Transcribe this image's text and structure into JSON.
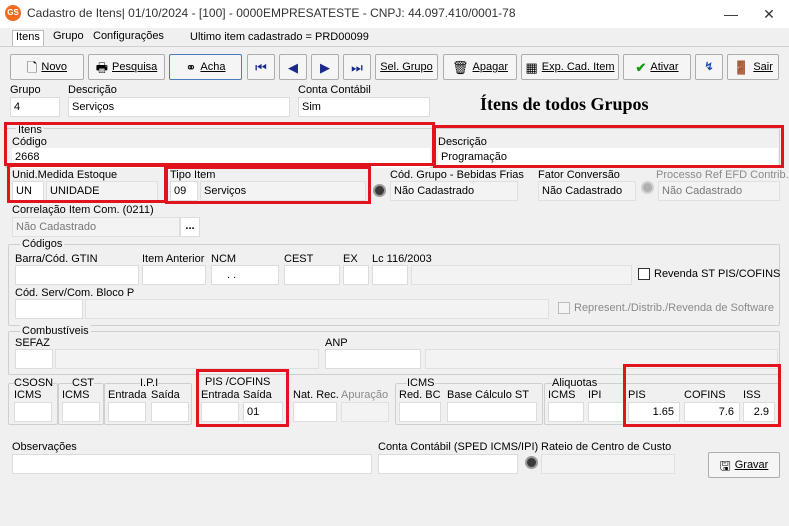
{
  "window": {
    "app_icon": "GS",
    "title": "Cadastro de Itens| 01/10/2024 - [100] - 0000EMPRESATESTE - CNPJ: 44.097.410/0001-78",
    "minimize": "—",
    "close": "✕"
  },
  "tabs": [
    "Itens",
    "Grupo",
    "Configurações"
  ],
  "last_item": "Ultimo item cadastrado = PRD00099",
  "toolbar": {
    "novo": "Novo",
    "pesquisa": "Pesquisa",
    "acha": "Acha",
    "sel_grupo": "Sel. Grupo",
    "apagar": "Apagar",
    "exp": "Exp. Cad. Item",
    "ativar": "Ativar",
    "sair": "Sair"
  },
  "header": {
    "grupo_label": "Grupo",
    "grupo_value": "4",
    "descricao_label": "Descrição",
    "descricao_value": "Serviços",
    "conta_label": "Conta Contábil",
    "conta_value": "Sim",
    "page_title": "Ítens de todos Grupos"
  },
  "itens": {
    "group_label": "Itens",
    "codigo_label": "Código",
    "codigo_value": "2668",
    "descricao_label": "Descrição",
    "descricao_value": "Programação"
  },
  "unidade": {
    "label": "Unid.Medida Estoque",
    "code": "UN",
    "name": "UNIDADE"
  },
  "tipo": {
    "label": "Tipo Item",
    "code": "09",
    "name": "Serviços"
  },
  "bebidas": {
    "label": "Cód. Grupo - Bebidas Frias",
    "value": "Não Cadastrado"
  },
  "fator": {
    "label": "Fator Conversão",
    "value": "Não Cadastrado"
  },
  "processo": {
    "label": "Processo Ref EFD Contrib.",
    "value": "Não Cadastrado"
  },
  "correlacao": {
    "label": "Correlação Item Com. (0211)",
    "value": "Não Cadastrado",
    "button": "..."
  },
  "codigos": {
    "group_label": "Códigos",
    "barra": "Barra/Cód. GTIN",
    "anterior": "Item Anterior",
    "ncm": "NCM",
    "ncm_value": ". .",
    "cest": "CEST",
    "ex": "EX",
    "lc": "Lc 116/2003",
    "revenda": "Revenda ST PIS/COFINS",
    "cod_serv": "Cód. Serv/Com. Bloco P",
    "represent": "Represent./Distrib./Revenda de Software"
  },
  "combustiveis": {
    "group_label": "Combustíveis",
    "sefaz": "SEFAZ",
    "anp": "ANP"
  },
  "taxes": {
    "csosn": "CSOSN",
    "icms1": "ICMS",
    "cst": "CST",
    "icms2": "ICMS",
    "entrada": "Entrada",
    "ipi": "I.P.I",
    "saida": "Saída",
    "pis_cofins": "PIS /COFINS",
    "pc_entrada": "Entrada",
    "pc_saida": "Saída",
    "pc_saida_value": "01",
    "nat_rec": "Nat. Rec.",
    "apuracao": "Apuração",
    "icms_group": "ICMS",
    "red_bc": "Red. BC",
    "base_calc": "Base Cálculo ST",
    "aliquotas": "Aliquotas",
    "al_icms": "ICMS",
    "al_ipi": "IPI",
    "pis": "PIS",
    "pis_value": "1.65",
    "cofins": "COFINS",
    "cofins_value": "7.6",
    "iss": "ISS",
    "iss_value": "2.9"
  },
  "footer": {
    "observacoes": "Observações",
    "conta_sped": "Conta Contábil (SPED ICMS/IPI)",
    "rateio": "Rateio de Centro de Custo",
    "gravar": "Gravar"
  },
  "colors": {
    "highlight": "#e0141c",
    "app_icon": "#f26a21"
  }
}
